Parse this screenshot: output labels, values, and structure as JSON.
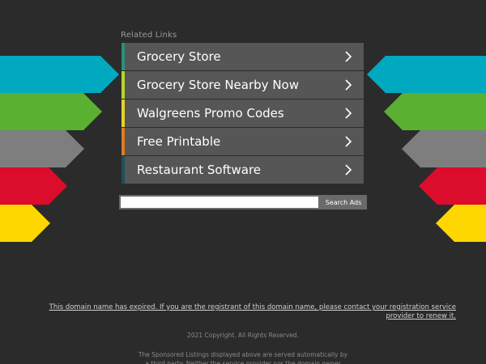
{
  "colors": {
    "background": "#2b2b2b",
    "row_background": "#565656",
    "arrow_cyan": "#00a9bf",
    "arrow_green": "#5ab031",
    "arrow_gray": "#7e7e7e",
    "arrow_red": "#db0c2c",
    "arrow_yellow": "#ffd700"
  },
  "related": {
    "header": "Related Links",
    "links": [
      {
        "label": "Grocery Store",
        "accent": "#2a8f7e",
        "icon": "chevron-right-icon"
      },
      {
        "label": "Grocery Store Nearby Now",
        "accent": "#b6d62c",
        "icon": "chevron-right-icon"
      },
      {
        "label": "Walgreens Promo Codes",
        "accent": "#e6d22a",
        "icon": "chevron-right-icon"
      },
      {
        "label": "Free Printable",
        "accent": "#e07b22",
        "icon": "chevron-right-icon"
      },
      {
        "label": "Restaurant Software",
        "accent": "#1f4f5a",
        "icon": "chevron-right-icon"
      }
    ]
  },
  "search": {
    "placeholder": "",
    "value": "",
    "button_label": "Search Ads"
  },
  "footer": {
    "expired_notice": "This domain name has expired. If you are the registrant of this domain name, please contact your registration service provider to renew it.",
    "copyright": "2021 Copyright. All Rights Reserved.",
    "disclaimer": "The Sponsored Listings displayed above are served automatically by a third party. Neither the service provider nor the domain owner"
  }
}
